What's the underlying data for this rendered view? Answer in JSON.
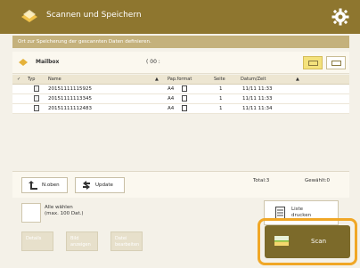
{
  "window": {
    "title": "Scannen und Speichern"
  },
  "notice": "Ort zur Speicherung der gescannten Daten definieren.",
  "mailbox": {
    "label": "Mailbox",
    "count_label": "( 00 :"
  },
  "table": {
    "headers": {
      "check": "✓",
      "type": "Typ",
      "name": "Name",
      "sort_indicator": "▲",
      "paper_format": "Pap.format",
      "pages": "Seite",
      "datetime": "Datum/Zeit",
      "datetime_sort": "▲"
    },
    "rows": [
      {
        "name": "20151111115925",
        "format": "A4",
        "pages": "1",
        "datetime": "11/11 11:33"
      },
      {
        "name": "20151111113345",
        "format": "A4",
        "pages": "1",
        "datetime": "11/11 11:33"
      },
      {
        "name": "20151111112483",
        "format": "A4",
        "pages": "1",
        "datetime": "11/11 11:34"
      }
    ]
  },
  "footer": {
    "back_label": "N.oben",
    "update_label": "Update",
    "total_label": "Total:3",
    "selected_label": "Gewählt:0"
  },
  "selection": {
    "select_all_line1": "Alle wählen",
    "select_all_line2": "(max. 100 Dat.)",
    "list_print_line1": "Liste",
    "list_print_line2": "drucken"
  },
  "bottom_buttons": {
    "details_label": "Details",
    "bild_line1": "Bild",
    "bild_line2": "anzeigen",
    "datei_line1": "Datei",
    "datei_line2": "bearbeiten",
    "scan_label": "Scan"
  },
  "colors": {
    "title_bar": "#8e762f",
    "notice_bar": "#c4b17c",
    "highlight": "#f0a726",
    "scan_button": "#7c6a2a",
    "active_view": "#f4e27c"
  }
}
